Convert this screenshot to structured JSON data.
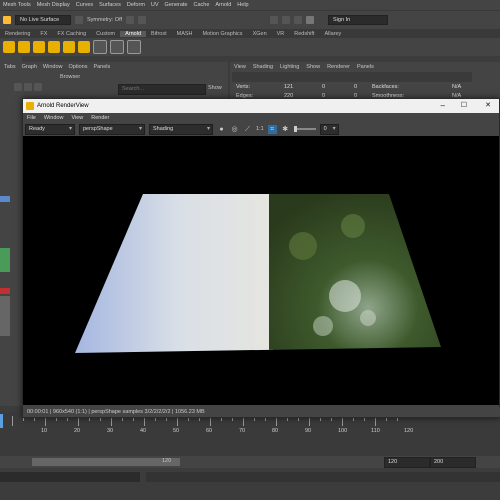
{
  "main_menu": [
    "Mesh Tools",
    "Mesh Display",
    "Curves",
    "Surfaces",
    "Deform",
    "UV",
    "Generate",
    "Cache",
    "Arnold",
    "Help"
  ],
  "status_line": {
    "live_surface": "No Live Surface",
    "symmetry": "Symmetry: Off",
    "sign_in": "Sign In"
  },
  "shelf_tabs": [
    "Rendering",
    "FX",
    "FX Caching",
    "Custom",
    "Arnold",
    "Bifrost",
    "MASH",
    "Motion Graphics",
    "XGen",
    "VR",
    "Redshift",
    "Allarey"
  ],
  "shelf_active_tab": "Arnold",
  "outliner": {
    "menus": [
      "Tabs",
      "Graph",
      "Window",
      "Options",
      "Panels"
    ],
    "browser_label": "Browser",
    "search_placeholder": "Search...",
    "show_label": "Show"
  },
  "viewport_panel": {
    "menus": [
      "View",
      "Shading",
      "Lighting",
      "Show",
      "Renderer",
      "Panels"
    ],
    "stats": {
      "verts_label": "Verts:",
      "verts": "121",
      "verts_a": "0",
      "verts_b": "0",
      "edges_label": "Edges:",
      "edges": "220",
      "edges_a": "0",
      "edges_b": "0",
      "backfaces_label": "Backfaces:",
      "backfaces": "N/A",
      "smoothness_label": "Smoothness:",
      "smoothness": "N/A"
    }
  },
  "render_view": {
    "title": "Arnold RenderView",
    "menus": [
      "File",
      "Window",
      "View",
      "Render"
    ],
    "status_dropdown": "Ready",
    "camera_dropdown": "perspShape",
    "aov_dropdown": "Shading",
    "zoom_label": "1:1",
    "exposure_value": "0",
    "status_text": "00:00:01 | 960x540 (1:1) | perspShape  samples 3/2/2/2/2/2 | 1056.23 MB"
  },
  "timeline": {
    "ticks": [
      "10",
      "20",
      "30",
      "40",
      "50",
      "60",
      "70",
      "80",
      "90",
      "100",
      "110",
      "120"
    ],
    "range_current": "120",
    "range_start": "120",
    "range_end": "200"
  },
  "colors": {
    "arnold_shelf_icon": "#e8b000",
    "selected_icon": "#2f6ea5",
    "render_bg": "#000000"
  }
}
